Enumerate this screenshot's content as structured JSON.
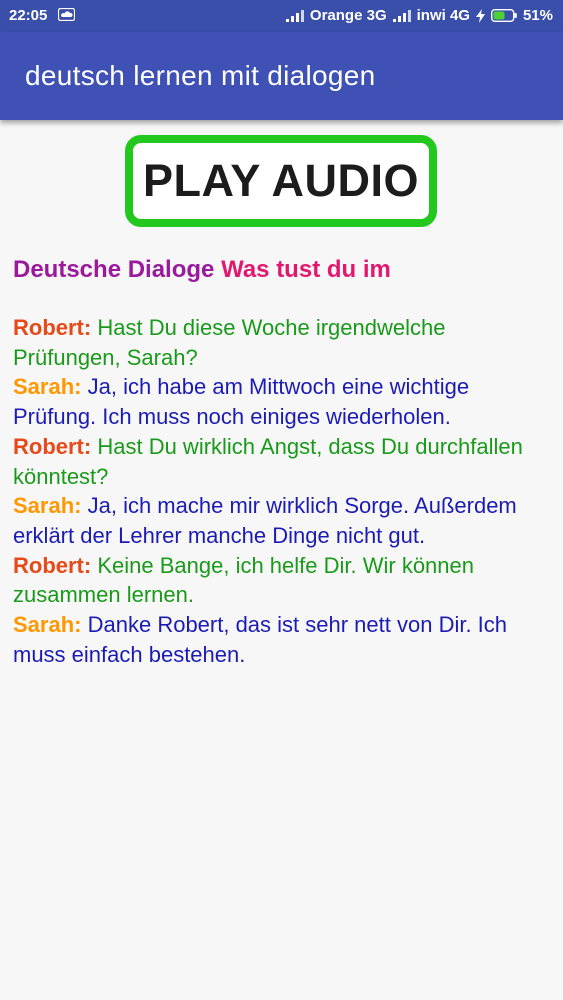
{
  "status_bar": {
    "time": "22:05",
    "carrier1": "Orange 3G",
    "carrier2": "inwi 4G",
    "battery": "51%",
    "icons": [
      "cloud-icon",
      "signal-icon",
      "signal-icon",
      "charging-bolt-icon",
      "battery-icon"
    ]
  },
  "app_bar": {
    "title": "deutsch lernen mit dialogen"
  },
  "play_button": {
    "label": "PLAY AUDIO"
  },
  "heading": {
    "part1": "Deutsche Dialoge",
    "part2": "Was tust du im"
  },
  "dialog": [
    {
      "speaker": "Robert:",
      "text": "Hast Du diese Woche irgendwelche Prüfungen, Sarah?"
    },
    {
      "speaker": "Sarah:",
      "text": "Ja, ich habe am Mittwoch eine wichtige Prüfung. Ich muss noch einiges wiederholen."
    },
    {
      "speaker": "Robert:",
      "text": "Hast Du wirklich Angst, dass Du durchfallen könntest?"
    },
    {
      "speaker": "Sarah:",
      "text": "Ja, ich mache mir wirklich Sorge. Außerdem erklärt der Lehrer manche Dinge nicht gut."
    },
    {
      "speaker": "Robert:",
      "text": "Keine Bange, ich helfe Dir. Wir können zusammen lernen."
    },
    {
      "speaker": "Sarah:",
      "text": "Danke Robert, das ist sehr nett von Dir. Ich muss einfach bestehen."
    }
  ],
  "colors": {
    "app_bar": "#3f51b5",
    "button_border": "#22c81e",
    "robert": "#e64a19",
    "sarah": "#ff9800",
    "robert_text": "#1a9a1a",
    "sarah_text": "#1c1cb4"
  }
}
